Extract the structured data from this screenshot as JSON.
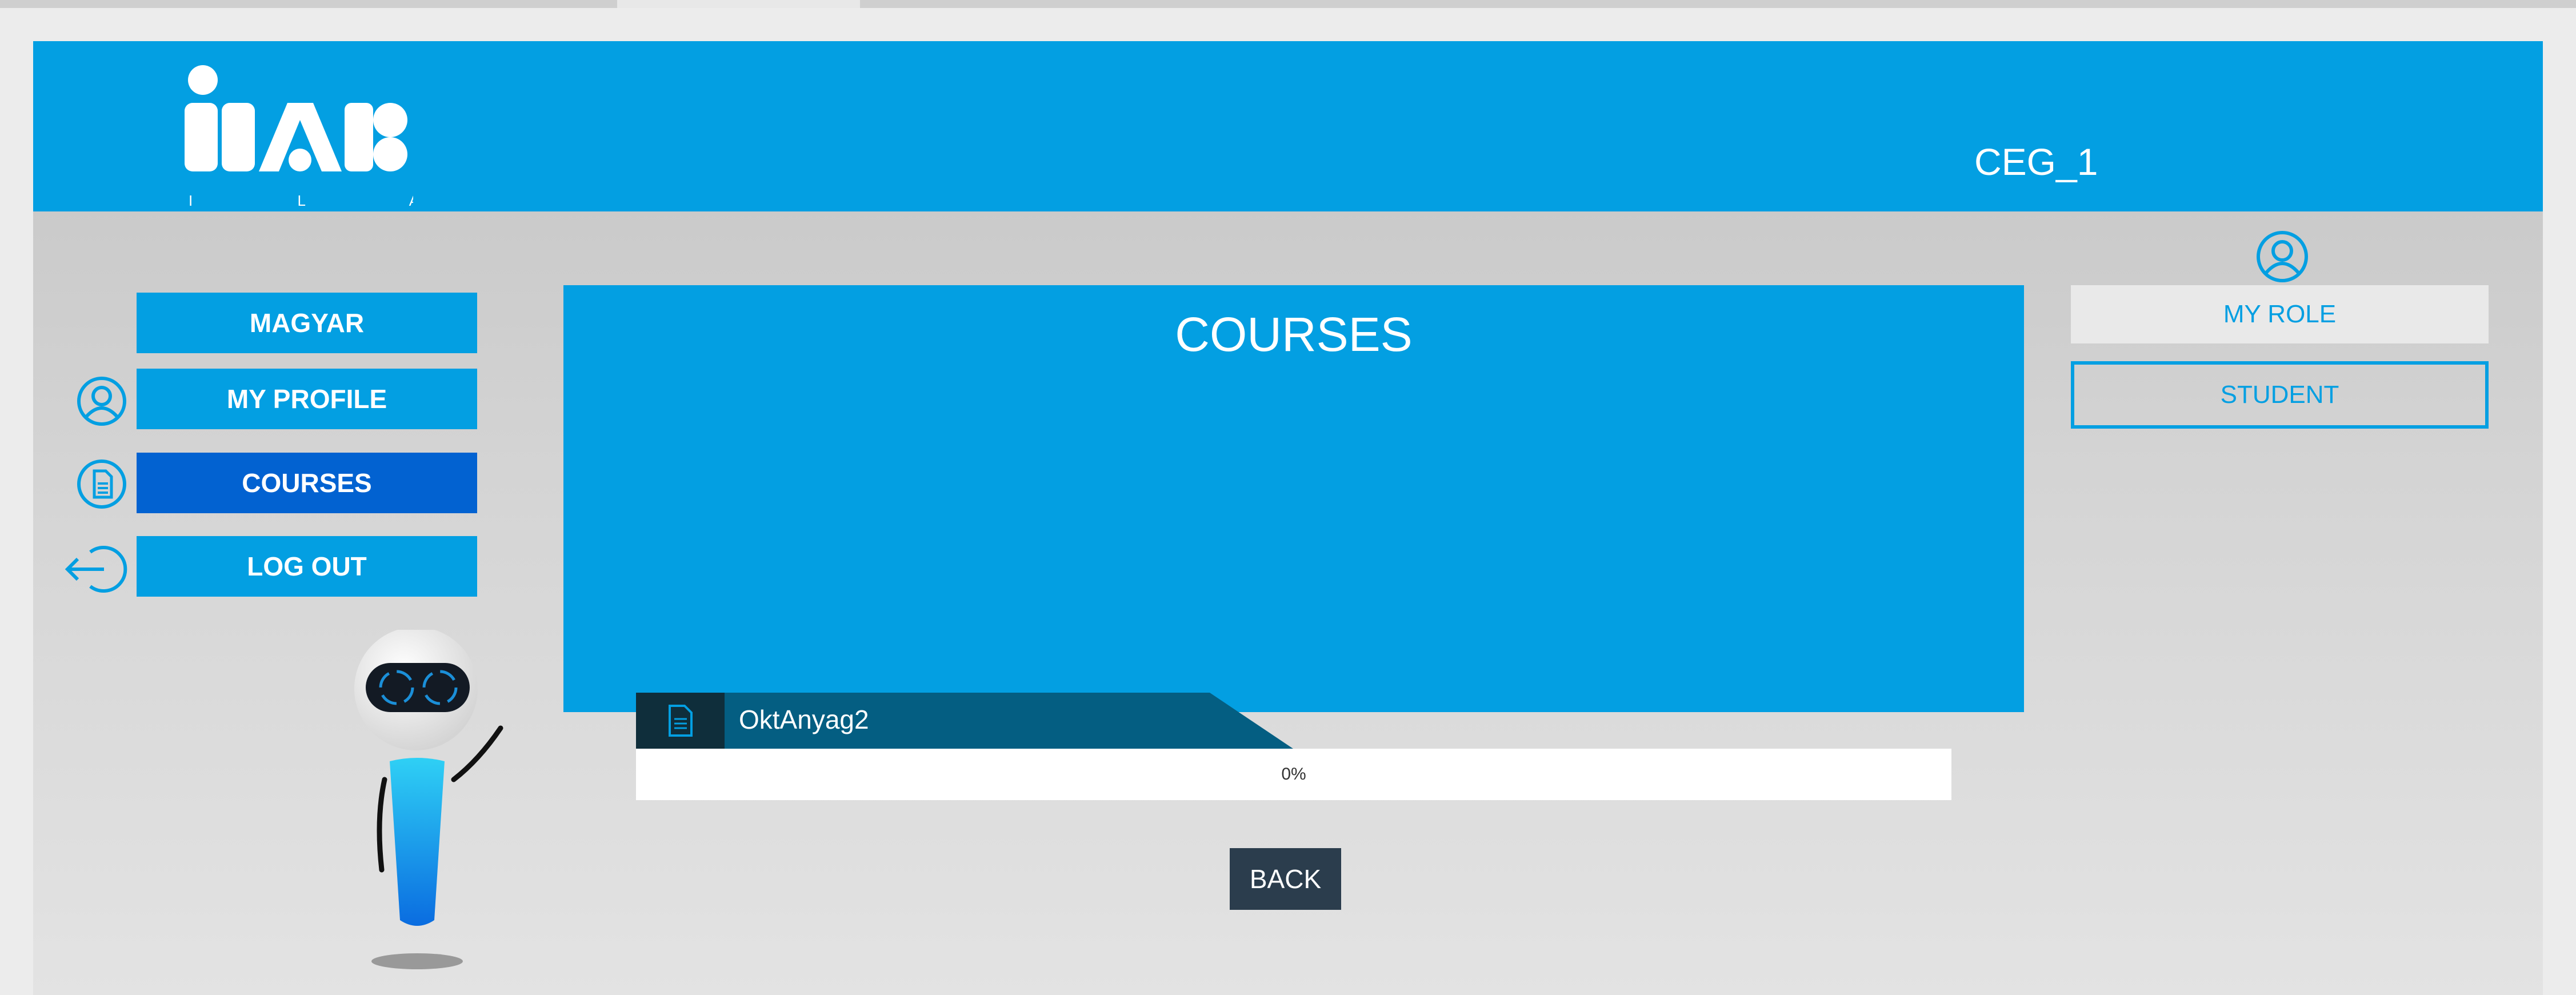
{
  "header": {
    "logo_letters": "I L A B",
    "username": "CEG_1"
  },
  "sidebar": {
    "items": [
      {
        "label": "MAGYAR",
        "icon": "none"
      },
      {
        "label": "MY PROFILE",
        "icon": "user-icon"
      },
      {
        "label": "COURSES",
        "icon": "document-icon",
        "active": true
      },
      {
        "label": "LOG OUT",
        "icon": "logout-icon"
      }
    ]
  },
  "main": {
    "title": "COURSES",
    "courses": [
      {
        "name": "OktAnyag2",
        "progress_label": "0%",
        "progress": 0
      }
    ],
    "back_label": "BACK"
  },
  "role_panel": {
    "header": "MY ROLE",
    "value": "STUDENT"
  },
  "colors": {
    "brand_blue": "#039fe2",
    "active_blue": "#0262d1",
    "dark_tab": "#045e82",
    "back_button": "#2b3d4d"
  }
}
